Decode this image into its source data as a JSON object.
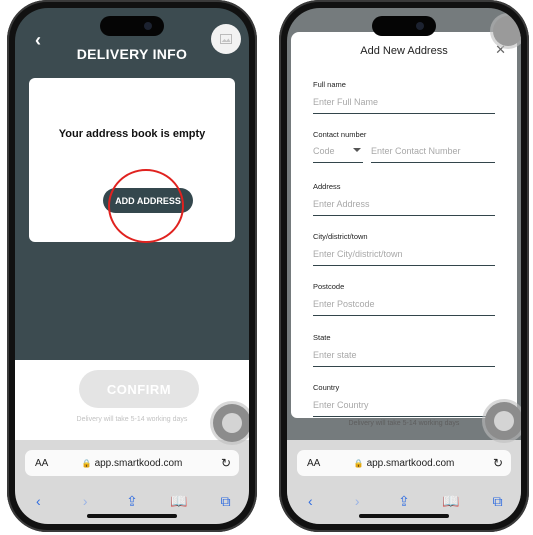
{
  "left": {
    "header": {
      "back_icon": "chevron-left-icon",
      "title": "DELIVERY INFO",
      "image_icon": "image-icon"
    },
    "card": {
      "empty_text": "Your address book is empty",
      "add_button": "ADD ADDRESS"
    },
    "confirm_button": "CONFIRM",
    "delivery_note": "Delivery will take 5-14 working days"
  },
  "right": {
    "modal": {
      "title": "Add New Address",
      "close": "✕",
      "fields": [
        {
          "label": "Full name",
          "placeholder": "Enter Full Name"
        },
        {
          "label": "Contact number",
          "code_placeholder": "Code",
          "placeholder": "Enter Contact Number"
        },
        {
          "label": "Address",
          "placeholder": "Enter Address"
        },
        {
          "label": "City/district/town",
          "placeholder": "Enter City/district/town"
        },
        {
          "label": "Postcode",
          "placeholder": "Enter Postcode"
        },
        {
          "label": "State",
          "placeholder": "Enter state"
        },
        {
          "label": "Country",
          "placeholder": "Enter Country"
        }
      ]
    },
    "delivery_note": "Delivery will take 5-14 working days"
  },
  "browser": {
    "text_size": "AA",
    "url": "app.smartkood.com",
    "toolbar_icons": [
      "back-icon",
      "forward-icon",
      "share-icon",
      "bookmarks-icon",
      "tabs-icon"
    ]
  },
  "colors": {
    "accent_dark": "#34474d",
    "highlight_circle": "#e0221f",
    "safari_blue": "#2f6ce0"
  }
}
